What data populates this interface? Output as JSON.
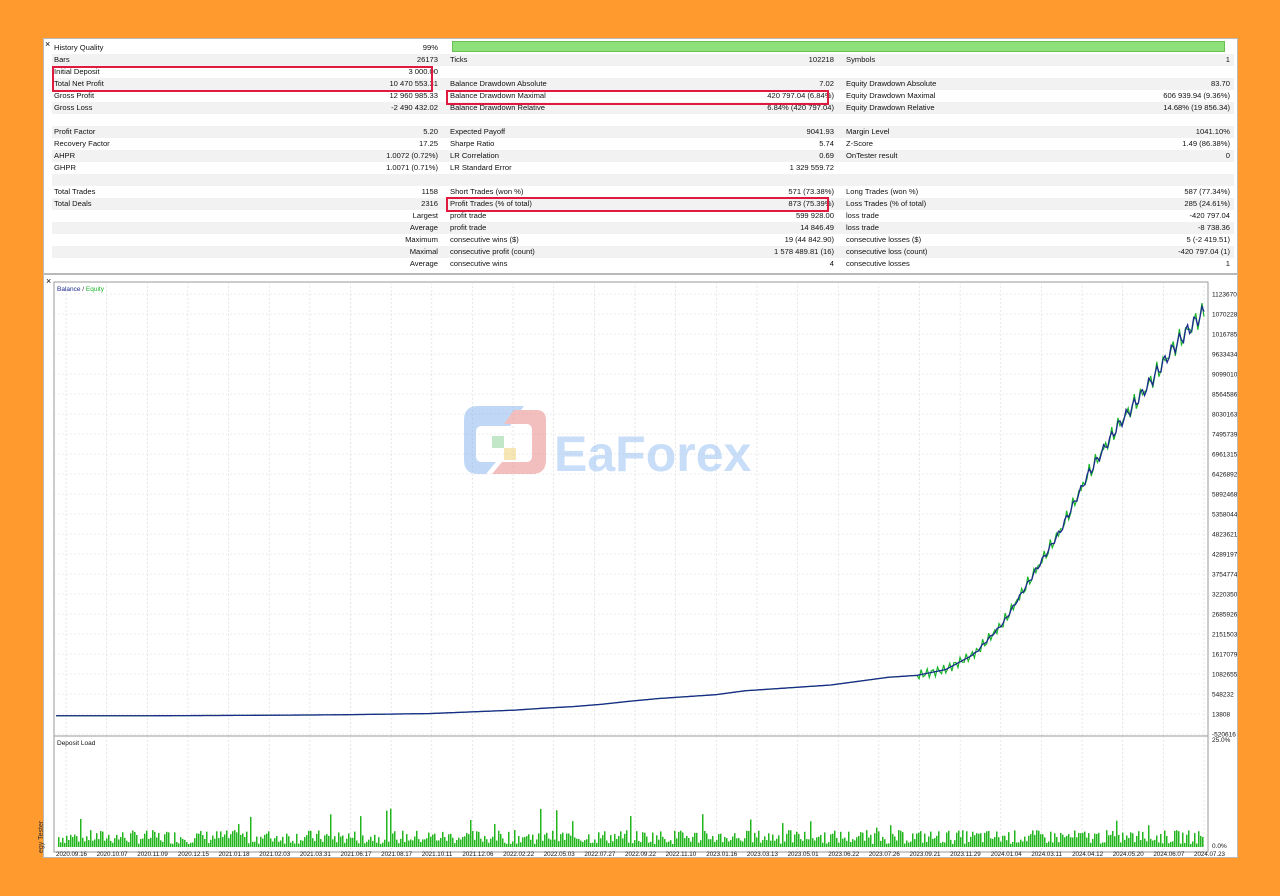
{
  "report": {
    "close_label": "×",
    "rows": [
      {
        "l1": "History Quality",
        "v1": "99%",
        "l2": "",
        "v2": "",
        "l3": "",
        "v3": "",
        "bar": true
      },
      {
        "l1": "Bars",
        "v1": "26173",
        "l2": "Ticks",
        "v2": "102218",
        "l3": "Symbols",
        "v3": "1"
      },
      {
        "l1": "Initial Deposit",
        "v1": "3 000.00",
        "l2": "",
        "v2": "",
        "l3": "",
        "v3": ""
      },
      {
        "l1": "Total Net Profit",
        "v1": "10 470 553.31",
        "l2": "Balance Drawdown Absolute",
        "v2": "7.02",
        "l3": "Equity Drawdown Absolute",
        "v3": "83.70"
      },
      {
        "l1": "Gross Profit",
        "v1": "12 960 985.33",
        "l2": "Balance Drawdown Maximal",
        "v2": "420 797.04 (6.84%)",
        "l3": "Equity Drawdown Maximal",
        "v3": "606 939.94 (9.36%)"
      },
      {
        "l1": "Gross Loss",
        "v1": "-2 490 432.02",
        "l2": "Balance Drawdown Relative",
        "v2": "6.84% (420 797.04)",
        "l3": "Equity Drawdown Relative",
        "v3": "14.68% (19 856.34)"
      },
      {
        "l1": "",
        "v1": "",
        "l2": "",
        "v2": "",
        "l3": "",
        "v3": ""
      },
      {
        "l1": "Profit Factor",
        "v1": "5.20",
        "l2": "Expected Payoff",
        "v2": "9041.93",
        "l3": "Margin Level",
        "v3": "1041.10%"
      },
      {
        "l1": "Recovery Factor",
        "v1": "17.25",
        "l2": "Sharpe Ratio",
        "v2": "5.74",
        "l3": "Z-Score",
        "v3": "1.49 (86.38%)"
      },
      {
        "l1": "AHPR",
        "v1": "1.0072 (0.72%)",
        "l2": "LR Correlation",
        "v2": "0.69",
        "l3": "OnTester result",
        "v3": "0"
      },
      {
        "l1": "GHPR",
        "v1": "1.0071 (0.71%)",
        "l2": "LR Standard Error",
        "v2": "1 329 559.72",
        "l3": "",
        "v3": ""
      },
      {
        "l1": "",
        "v1": "",
        "l2": "",
        "v2": "",
        "l3": "",
        "v3": ""
      },
      {
        "l1": "Total Trades",
        "v1": "1158",
        "l2": "Short Trades (won %)",
        "v2": "571 (73.38%)",
        "l3": "Long Trades (won %)",
        "v3": "587 (77.34%)"
      },
      {
        "l1": "Total Deals",
        "v1": "2316",
        "l2": "Profit Trades (% of total)",
        "v2": "873 (75.39%)",
        "l3": "Loss Trades (% of total)",
        "v3": "285 (24.61%)"
      },
      {
        "l1": "",
        "v1": "Largest",
        "l2": "profit trade",
        "v2": "599 928.00",
        "l3": "loss trade",
        "v3": "-420 797.04"
      },
      {
        "l1": "",
        "v1": "Average",
        "l2": "profit trade",
        "v2": "14 846.49",
        "l3": "loss trade",
        "v3": "-8 738.36"
      },
      {
        "l1": "",
        "v1": "Maximum",
        "l2": "consecutive wins ($)",
        "v2": "19 (44 842.90)",
        "l3": "consecutive losses ($)",
        "v3": "5 (-2 419.51)"
      },
      {
        "l1": "",
        "v1": "Maximal",
        "l2": "consecutive profit (count)",
        "v2": "1 578 489.81 (16)",
        "l3": "consecutive loss (count)",
        "v3": "-420 797.04 (1)"
      },
      {
        "l1": "",
        "v1": "Average",
        "l2": "consecutive wins",
        "v2": "4",
        "l3": "consecutive losses",
        "v3": "1"
      }
    ]
  },
  "chart": {
    "close_label": "×",
    "legend_balance": "Balance",
    "legend_sep": " / ",
    "legend_equity": "Equity",
    "deposit_label": "Deposit Load",
    "side_label": "egy Tester",
    "colors": {
      "balance": "#1b2a8c",
      "equity": "#19b42a",
      "load": "#22b51e",
      "grid": "#d8d8d8"
    },
    "watermark": "EaForex"
  },
  "chart_data": [
    {
      "type": "line",
      "series": [
        {
          "name": "Balance",
          "values": [
            3000,
            3000,
            3000,
            4000,
            6000,
            9000,
            12000,
            15000,
            20000,
            24000,
            30000,
            40000,
            50000,
            60000,
            90000,
            120000,
            150000,
            200000,
            240000,
            300000,
            380000,
            450000,
            500000,
            550000,
            650000,
            700000,
            750000,
            800000,
            900000,
            1000000,
            1050000,
            1200000,
            1600000,
            2400000,
            3600000,
            4800000,
            6300000,
            7500000,
            8500000,
            9600000,
            10470000
          ]
        },
        {
          "name": "Equity"
        }
      ],
      "y_ticks": [
        "11236704",
        "10702281",
        "10167857",
        "9633434",
        "9099010",
        "8564586",
        "8030163",
        "7495739",
        "6961315",
        "6426892",
        "5892468",
        "5358044",
        "4823621",
        "4289197",
        "3754774",
        "3220350",
        "2685926",
        "2151503",
        "1617079",
        "1082655",
        "548232",
        "13808",
        "-520616"
      ],
      "x_ticks": [
        "2020.09.16",
        "2020.10.07",
        "2020.11.09",
        "2020.12.15",
        "2021.01.18",
        "2021.02.03",
        "2021.03.31",
        "2021.06.17",
        "2021.08.17",
        "2021.10.11",
        "2021.12.06",
        "2022.02.22",
        "2022.05.03",
        "2022.07.27",
        "2022.09.22",
        "2022.11.10",
        "2023.01.16",
        "2023.03.13",
        "2023.05.01",
        "2023.06.22",
        "2023.07.26",
        "2023.09.21",
        "2023.11.29",
        "2024.01.04",
        "2024.03.11",
        "2024.04.12",
        "2024.05.20",
        "2024.06.07",
        "2024.07.23"
      ],
      "ylim": [
        -520616,
        11236704
      ]
    },
    {
      "type": "bar",
      "title": "Deposit Load",
      "y_ticks": [
        "25.0%",
        "0.0%"
      ],
      "ylim": [
        0,
        25
      ]
    }
  ]
}
